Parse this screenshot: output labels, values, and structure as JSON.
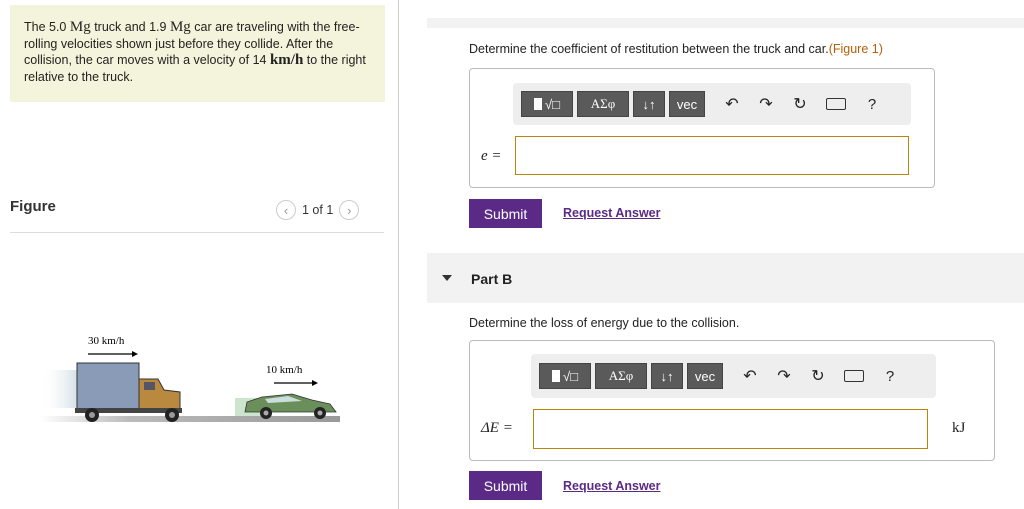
{
  "problem": {
    "text_1": "The 5.0 ",
    "unit_mg": "Mg",
    "text_2": " truck and 1.9 ",
    "text_3": " car are traveling with the free-rolling velocities shown just before they collide. After the collision, the car moves with a velocity of 14 ",
    "unit_kmh": "km/h",
    "text_4": " to the right relative to the truck."
  },
  "figure": {
    "label": "Figure",
    "counter": "1 of 1",
    "prev_icon": "chevron-left-icon",
    "next_icon": "chevron-right-icon",
    "truck_speed": "30 km/h",
    "car_speed": "10 km/h"
  },
  "part_a": {
    "question": "Determine the coefficient of restitution between the truck and car.",
    "figure_link": "(Figure 1)",
    "var_label": "e =",
    "toolbar": {
      "templates": "√□",
      "greek": "ΑΣφ",
      "arrows": "↓↑",
      "vec": "vec",
      "help": "?"
    },
    "submit": "Submit",
    "request": "Request Answer"
  },
  "part_b": {
    "label": "Part B",
    "question": "Determine the loss of energy due to the collision.",
    "var_label": "ΔE =",
    "unit": "kJ",
    "toolbar": {
      "templates": "√□",
      "greek": "ΑΣφ",
      "arrows": "↓↑",
      "vec": "vec",
      "help": "?"
    },
    "submit": "Submit",
    "request": "Request Answer"
  }
}
